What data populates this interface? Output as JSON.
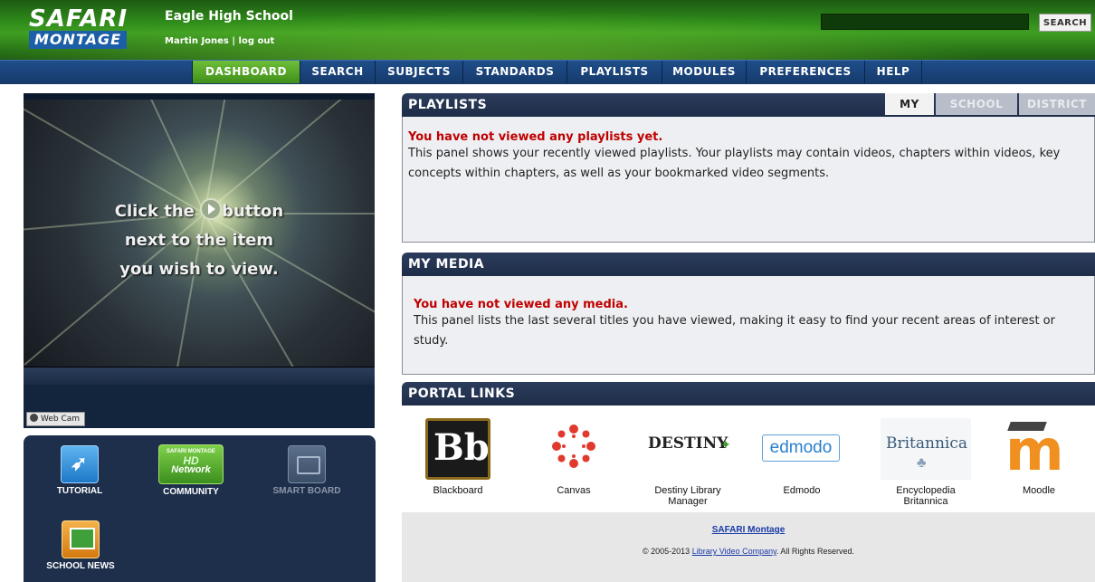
{
  "header": {
    "logo_top": "SAFARI",
    "logo_bottom": "MONTAGE",
    "school_name": "Eagle High School",
    "user_name": "Martin Jones",
    "separator": "|",
    "logout_label": "log out",
    "search_value": "",
    "search_button": "SEARCH"
  },
  "nav": {
    "items": [
      {
        "label": "DASHBOARD",
        "active": true
      },
      {
        "label": "SEARCH"
      },
      {
        "label": "SUBJECTS"
      },
      {
        "label": "STANDARDS"
      },
      {
        "label": "PLAYLISTS"
      },
      {
        "label": "MODULES"
      },
      {
        "label": "PREFERENCES"
      },
      {
        "label": "HELP"
      }
    ]
  },
  "video": {
    "line1_pre": "Click the",
    "line1_post": "button",
    "line2": "next to the item",
    "line3": "you wish to view.",
    "webcam_label": "Web Cam"
  },
  "tools": {
    "tutorial": "TUTORIAL",
    "community": "COMMUNITY",
    "network_line1": "SAFARI MONTAGE",
    "network_line2": "HD",
    "network_line3": "Network",
    "smart_board": "SMART BOARD",
    "school_news": "SCHOOL NEWS"
  },
  "playlists": {
    "title": "PLAYLISTS",
    "tabs": [
      "MY",
      "SCHOOL",
      "DISTRICT"
    ],
    "empty_message": "You have not viewed any playlists yet.",
    "description": "This panel shows your recently viewed playlists. Your playlists may contain videos, chapters within videos, key concepts within chapters, as well as your bookmarked video segments."
  },
  "my_media": {
    "title": "MY MEDIA",
    "empty_message": "You have not viewed any media.",
    "description": "This panel lists the last several titles you have viewed, making it easy to find your recent areas of interest or study."
  },
  "portal_links": {
    "title": "PORTAL LINKS",
    "items": [
      {
        "label": "Blackboard",
        "logo": "Bb"
      },
      {
        "label": "Canvas"
      },
      {
        "label": "Destiny Library Manager",
        "logo": "DESTINY"
      },
      {
        "label": "Edmodo",
        "logo": "edmodo"
      },
      {
        "label": "Encyclopedia Britannica",
        "logo": "Britannica"
      },
      {
        "label": "Moodle",
        "logo": "m"
      }
    ]
  },
  "footer": {
    "brand_link": "SAFARI Montage",
    "copyright_pre": "© 2005-2013",
    "company_link": "Library Video Company",
    "copyright_post": ". All Rights Reserved."
  },
  "colors": {
    "header_green": "#2e8a1a",
    "nav_blue": "#1f4e8a",
    "panel_header": "#24344f",
    "alert_red": "#c00000"
  }
}
